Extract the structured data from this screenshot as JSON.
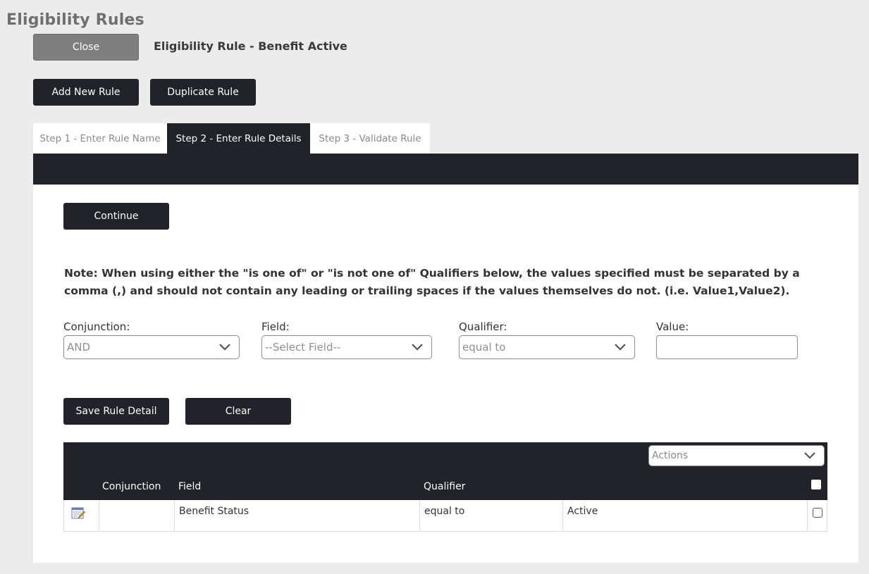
{
  "page": {
    "title": "Eligibility Rules",
    "rule_heading": "Eligibility Rule - Benefit Active"
  },
  "toolbar": {
    "close_label": "Close",
    "add_new_rule_label": "Add New Rule",
    "duplicate_rule_label": "Duplicate Rule"
  },
  "tabs": [
    {
      "label": "Step 1 - Enter Rule Name",
      "active": false
    },
    {
      "label": "Step 2 - Enter Rule Details",
      "active": true
    },
    {
      "label": "Step 3 - Validate Rule",
      "active": false
    }
  ],
  "form": {
    "continue_label": "Continue",
    "note": "Note: When using either the \"is one of\" or \"is not one of\" Qualifiers below, the values specified must be separated by a comma (,) and should not contain any leading or trailing spaces if the values themselves do not. (i.e. Value1,Value2).",
    "conjunction": {
      "label": "Conjunction:",
      "value": "AND"
    },
    "field": {
      "label": "Field:",
      "value": "--Select Field--"
    },
    "qualifier": {
      "label": "Qualifier:",
      "value": "equal to"
    },
    "value": {
      "label": "Value:",
      "value": ""
    },
    "save_label": "Save Rule Detail",
    "clear_label": "Clear"
  },
  "table": {
    "actions_placeholder": "Actions",
    "headers": {
      "conjunction": "Conjunction",
      "field": "Field",
      "qualifier": "Qualifier"
    },
    "rows": [
      {
        "conjunction": "",
        "field": "Benefit Status",
        "qualifier": "equal to",
        "value": "Active"
      }
    ]
  },
  "icons": {
    "chevron": "chevron-down-icon",
    "edit": "edit-icon"
  }
}
